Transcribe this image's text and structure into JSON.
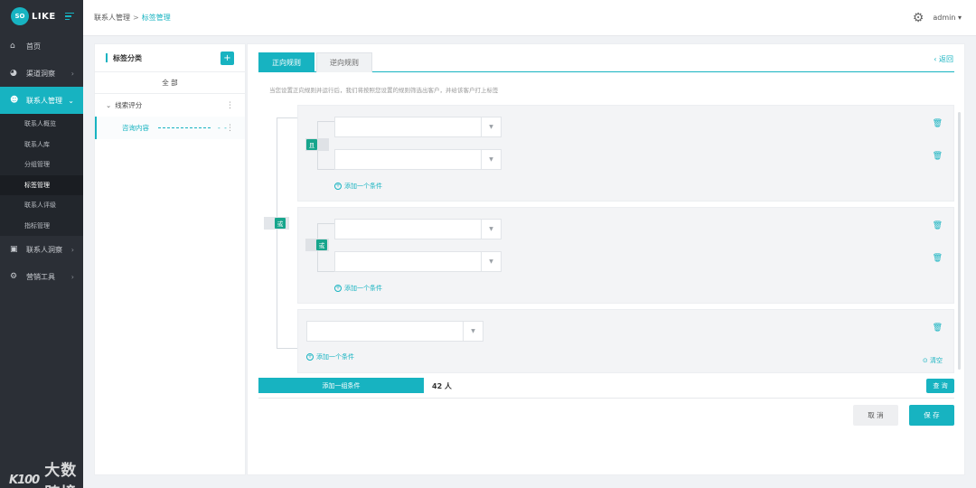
{
  "brand": {
    "logo_badge": "SO",
    "logo_text": "LIKE"
  },
  "sidebar": {
    "items": [
      {
        "label": "首页",
        "icon": "home-icon"
      },
      {
        "label": "渠道洞察",
        "icon": "pie-chart-icon"
      },
      {
        "label": "联系人管理",
        "icon": "users-icon"
      },
      {
        "label": "联系人洞察",
        "icon": "id-card-icon"
      },
      {
        "label": "营销工具",
        "icon": "tools-icon"
      }
    ],
    "sub_items": [
      "联系人概览",
      "联系人库",
      "分组管理",
      "标签管理",
      "联系人评级",
      "指标管理"
    ]
  },
  "watermark": {
    "mark": "K100",
    "text": "大数跨境"
  },
  "header": {
    "breadcrumb_parent": "联系人管理",
    "breadcrumb_sep": ">",
    "breadcrumb_current": "标签管理",
    "user": "admin"
  },
  "tag_panel": {
    "title": "标签分类",
    "add": "+",
    "all": "全 部",
    "group": "线索评分",
    "leaf": "咨询内容",
    "leaf_dots": "- -"
  },
  "rules": {
    "tab_forward": "正向规则",
    "tab_reverse": "逆向规则",
    "back": "返回",
    "hint": "当您设置正向规则并运行后，我们将按照您设置的规则筛选出客户，并给该客户打上标签",
    "outer_relation": "或",
    "groups": [
      {
        "relation": "且",
        "add_label": "添加一个条件"
      },
      {
        "relation": "或",
        "add_label": "添加一个条件"
      },
      {
        "add_label": "添加一个条件",
        "clear": "清空"
      }
    ],
    "add_group": "添加一组条件",
    "count": "42 人",
    "query": "查 询",
    "cancel": "取 消",
    "save": "保 存"
  },
  "colors": {
    "accent": "#17b3c1",
    "relation": "#17a58c",
    "sidebar": "#2b2f36"
  }
}
